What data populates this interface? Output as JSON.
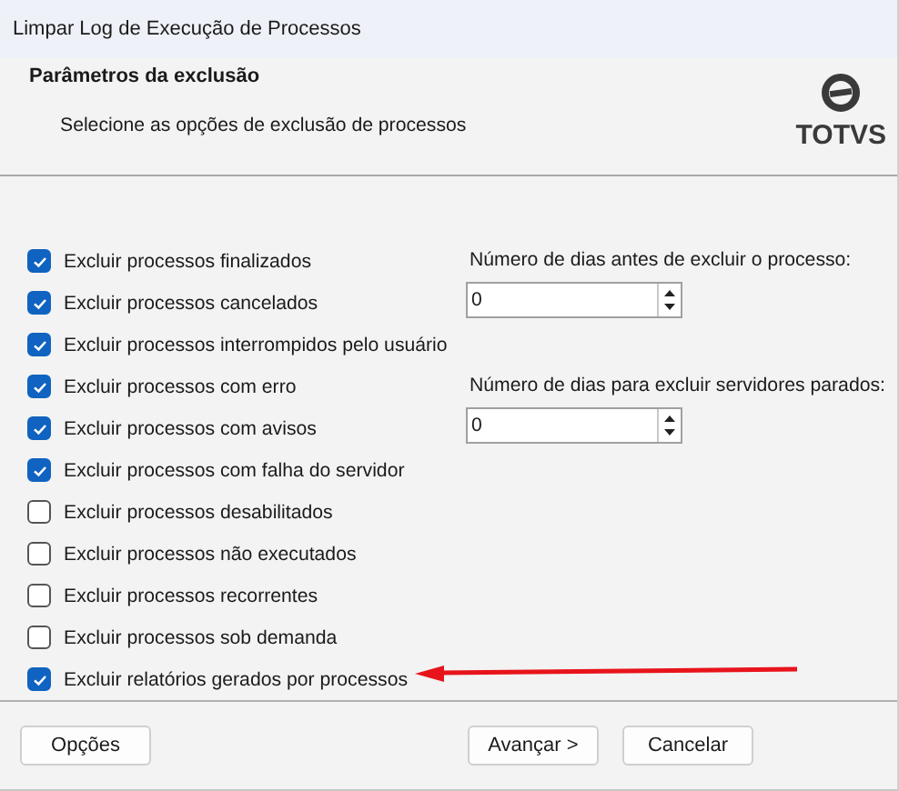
{
  "window": {
    "title": "Limpar Log de Execução de Processos"
  },
  "header": {
    "title": "Parâmetros da exclusão",
    "subtitle": "Selecione as opções de exclusão de processos",
    "logo_text": "TOTVS"
  },
  "options": [
    {
      "label": "Excluir processos finalizados",
      "checked": true
    },
    {
      "label": "Excluir processos cancelados",
      "checked": true
    },
    {
      "label": "Excluir processos interrompidos pelo usuário",
      "checked": true
    },
    {
      "label": "Excluir processos com erro",
      "checked": true
    },
    {
      "label": "Excluir processos com avisos",
      "checked": true
    },
    {
      "label": "Excluir processos com falha do servidor",
      "checked": true
    },
    {
      "label": "Excluir processos desabilitados",
      "checked": false
    },
    {
      "label": "Excluir processos não executados",
      "checked": false
    },
    {
      "label": "Excluir processos recorrentes",
      "checked": false
    },
    {
      "label": "Excluir processos sob demanda",
      "checked": false
    },
    {
      "label": "Excluir relatórios gerados por processos",
      "checked": true
    }
  ],
  "fields": [
    {
      "label": "Número de dias antes de excluir o processo:",
      "value": "0"
    },
    {
      "label": "Número de dias para excluir servidores parados:",
      "value": "0"
    }
  ],
  "buttons": {
    "left": "Opções",
    "next": "Avançar >",
    "cancel": "Cancelar"
  }
}
